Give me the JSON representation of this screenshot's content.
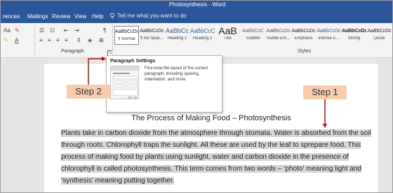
{
  "window": {
    "title": "Photosynthesis - Word"
  },
  "menu": {
    "tabs": [
      "rences",
      "Mailings",
      "Review",
      "View",
      "Help"
    ],
    "tell_me": "Tell me what you want to do",
    "tell_me_icon": "lightbulb-icon"
  },
  "ribbon": {
    "paragraph_group_label": "Paragraph",
    "styles_group_label": "Styles",
    "launcher_glyph": "↘",
    "font_controls": [
      "Aa",
      "A"
    ],
    "paragraph_controls": [
      "☰",
      "☷",
      "⇤",
      "⇥",
      "¶"
    ],
    "styles": [
      {
        "sample": "AaBbCcDc",
        "name": "¶ Normal"
      },
      {
        "sample": "AaBbCcDc",
        "name": "¶ No Spac..."
      },
      {
        "sample": "AaBbCc",
        "name": "Heading 1"
      },
      {
        "sample": "AaBbCcC",
        "name": "Heading 2"
      },
      {
        "sample": "AaB",
        "name": "Title"
      },
      {
        "sample": "AaBbCcC",
        "name": "Subtitle"
      },
      {
        "sample": "AaBbCcDc",
        "name": "Subtle Em..."
      },
      {
        "sample": "AaBbCcDc",
        "name": "Emphasis"
      },
      {
        "sample": "AaBbCcDc",
        "name": "Intense E..."
      },
      {
        "sample": "AaBbCcDc",
        "name": "Strong"
      },
      {
        "sample": "AaBbCcDc",
        "name": "Quote"
      }
    ]
  },
  "tooltip": {
    "title": "Paragraph Settings",
    "description": "Fine-tune the layout of the current paragraph, including spacing, indentation, and more."
  },
  "callouts": {
    "step1": "Step 1",
    "step2": "Step 2",
    "color": "#f8cbad",
    "arrow_color": "#c00000"
  },
  "document": {
    "heading": "The Process of Making Food – Photosynthesis",
    "body": "Plants take in carbon dioxide from the atmosphere through stomata. Water is absorbed from the soil through roots. Chlorophyll traps the sunlight. All these are used by the leaf to sprepare food. This process of making food by plants using sunlight, water and carbon dioxide in the presence of chlorophyll is called photosynthesis. This term comes from two words – ‘photo’ meaning light and ‘synthesis’ meaning putting together."
  },
  "colors": {
    "title_bar": "#2b579a",
    "ribbon": "#f3f3f3",
    "selection": "#d6d6d6"
  }
}
